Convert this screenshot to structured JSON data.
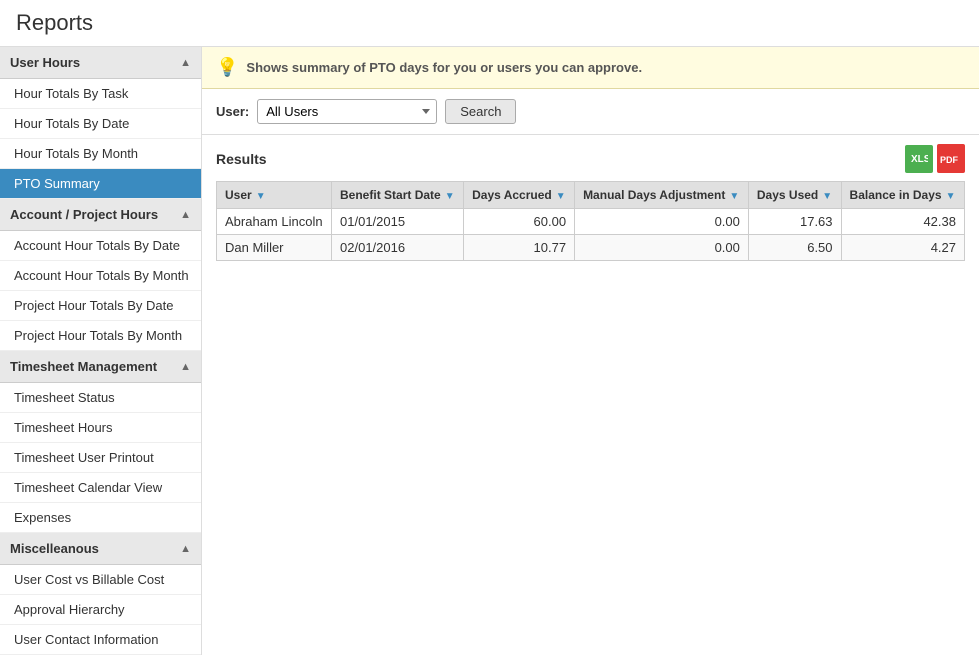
{
  "page": {
    "title": "Reports"
  },
  "sidebar": {
    "groups": [
      {
        "id": "user-hours",
        "label": "User Hours",
        "expanded": true,
        "items": [
          {
            "id": "hour-totals-by-task",
            "label": "Hour Totals By Task",
            "active": false
          },
          {
            "id": "hour-totals-by-date",
            "label": "Hour Totals By Date",
            "active": false
          },
          {
            "id": "hour-totals-by-month",
            "label": "Hour Totals By Month",
            "active": false
          },
          {
            "id": "pto-summary",
            "label": "PTO Summary",
            "active": true
          }
        ]
      },
      {
        "id": "account-project-hours",
        "label": "Account / Project Hours",
        "expanded": true,
        "items": [
          {
            "id": "account-hour-totals-by-date",
            "label": "Account Hour Totals By Date",
            "active": false
          },
          {
            "id": "account-hour-totals-by-month",
            "label": "Account Hour Totals By Month",
            "active": false
          },
          {
            "id": "project-hour-totals-by-date",
            "label": "Project Hour Totals By Date",
            "active": false
          },
          {
            "id": "project-hour-totals-by-month",
            "label": "Project Hour Totals By Month",
            "active": false
          }
        ]
      },
      {
        "id": "timesheet-management",
        "label": "Timesheet Management",
        "expanded": true,
        "items": [
          {
            "id": "timesheet-status",
            "label": "Timesheet Status",
            "active": false
          },
          {
            "id": "timesheet-hours",
            "label": "Timesheet Hours",
            "active": false
          },
          {
            "id": "timesheet-user-printout",
            "label": "Timesheet User Printout",
            "active": false
          },
          {
            "id": "timesheet-calendar-view",
            "label": "Timesheet Calendar View",
            "active": false
          },
          {
            "id": "expenses",
            "label": "Expenses",
            "active": false
          }
        ]
      },
      {
        "id": "miscellaneous",
        "label": "Miscelleanous",
        "expanded": true,
        "items": [
          {
            "id": "user-cost-vs-billable-cost",
            "label": "User Cost vs Billable Cost",
            "active": false
          },
          {
            "id": "approval-hierarchy",
            "label": "Approval Hierarchy",
            "active": false
          },
          {
            "id": "user-contact-information",
            "label": "User Contact Information",
            "active": false
          }
        ]
      }
    ]
  },
  "main": {
    "info_message": "Shows summary of PTO days for you or users you can approve.",
    "filter": {
      "user_label": "User:",
      "user_options": [
        "All Users",
        "Abraham Lincoln",
        "Dan Miller"
      ],
      "user_selected": "All Users",
      "search_label": "Search"
    },
    "results": {
      "title": "Results",
      "export_excel_label": "XLS",
      "export_pdf_label": "PDF",
      "columns": [
        {
          "id": "user",
          "label": "User"
        },
        {
          "id": "benefit-start-date",
          "label": "Benefit Start Date"
        },
        {
          "id": "days-accrued",
          "label": "Days Accrued"
        },
        {
          "id": "manual-days-adjustment",
          "label": "Manual Days Adjustment"
        },
        {
          "id": "days-used",
          "label": "Days Used"
        },
        {
          "id": "balance-in-days",
          "label": "Balance in Days"
        }
      ],
      "rows": [
        {
          "user": "Abraham Lincoln",
          "benefit_start_date": "01/01/2015",
          "days_accrued": "60.00",
          "manual_days_adjustment": "0.00",
          "days_used": "17.63",
          "balance_in_days": "42.38"
        },
        {
          "user": "Dan Miller",
          "benefit_start_date": "02/01/2016",
          "days_accrued": "10.77",
          "manual_days_adjustment": "0.00",
          "days_used": "6.50",
          "balance_in_days": "4.27"
        }
      ]
    }
  }
}
